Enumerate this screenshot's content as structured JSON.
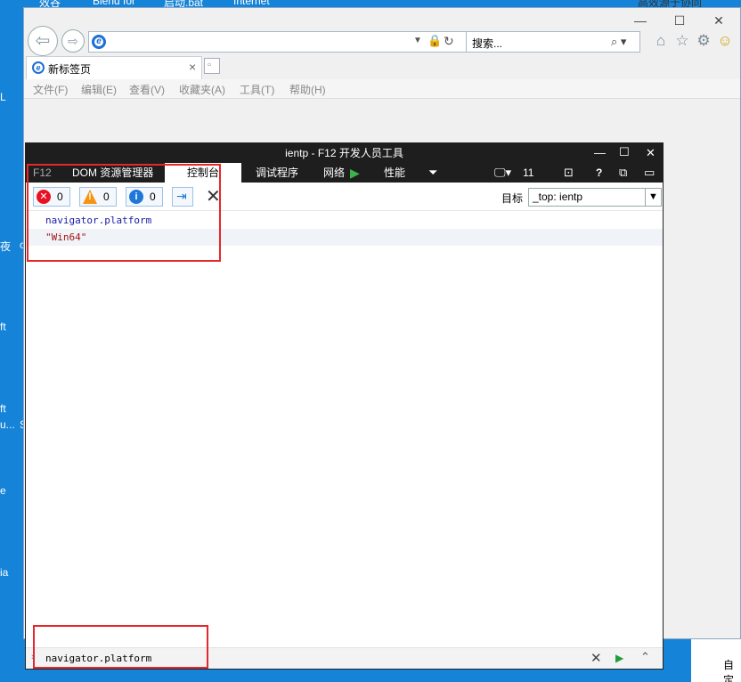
{
  "desktop": {
    "top_labels": [
      "效谷",
      "Blend for",
      "启动.bat",
      "Internet"
    ],
    "right_top_label": "高效源于协同",
    "left_labels": [
      "L",
      "夜",
      "ft",
      "ft",
      "u...",
      "e",
      "ia"
    ],
    "mid_labels": [
      "c",
      "S"
    ],
    "bottom_right_label": "自定"
  },
  "ie": {
    "address_value": "",
    "search_placeholder": "搜索...",
    "search_icon": "⌕ ▾",
    "tab_title": "新标签页",
    "tab_close": "×",
    "menu": [
      "文件(F)",
      "编辑(E)",
      "查看(V)",
      "收藏夹(A)",
      "工具(T)",
      "帮助(H)"
    ],
    "window_controls": {
      "minimize": "—",
      "maximize": "☐",
      "close": "✕"
    }
  },
  "devtools": {
    "title": "ientp - F12 开发人员工具",
    "tabs": [
      "F12",
      "DOM 资源管理器",
      "控制台",
      "调试程序",
      "网络",
      "性能"
    ],
    "active_tab": "控制台",
    "emulation_label": "11",
    "counters": {
      "errors": "0",
      "warnings": "0",
      "info": "0"
    },
    "target_label": "目标",
    "target_value": "_top: ientp",
    "console_lines": [
      {
        "text": "navigator.platform",
        "type": "input"
      },
      {
        "text": "\"Win64\"",
        "type": "result"
      }
    ],
    "input_value": "navigator.platform",
    "colors": {
      "input_text": "#1a1aa6",
      "result_text": "#a31515",
      "highlight": "#e4282b"
    }
  }
}
